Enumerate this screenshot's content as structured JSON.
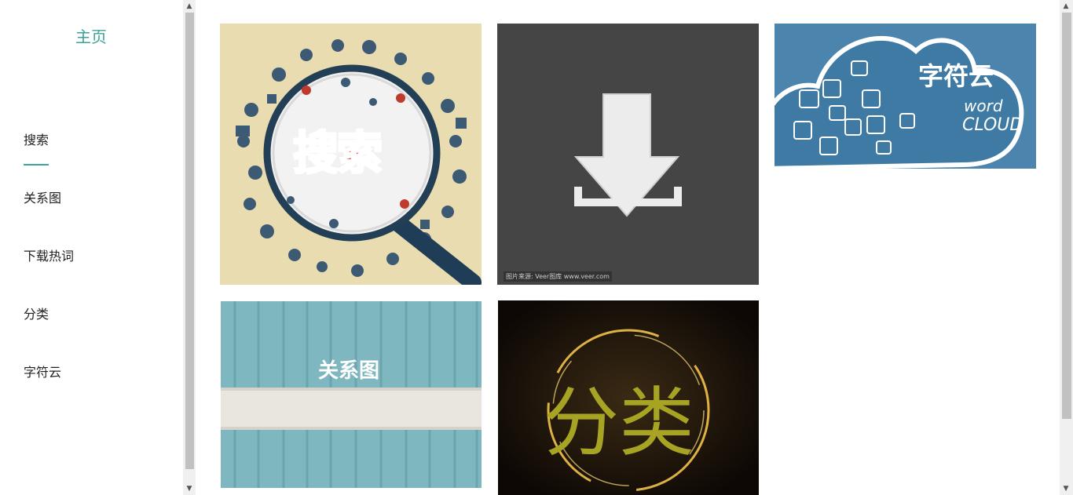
{
  "sidebar": {
    "home_label": "主页",
    "items": [
      {
        "label": "搜索"
      },
      {
        "label": "关系图"
      },
      {
        "label": "下载热词"
      },
      {
        "label": "分类"
      },
      {
        "label": "字符云"
      }
    ],
    "accent_color": "#3aa39a"
  },
  "tiles": {
    "search": {
      "text": "搜索",
      "bg_color": "#eadcb1"
    },
    "download": {
      "caption": "图片来源: Veer图库 www.veer.com",
      "bg_color": "#454545"
    },
    "wordcloud": {
      "title": "字符云",
      "word": "word",
      "cloud": "CLOUD",
      "bg_color": "#4b84ad"
    },
    "relation": {
      "text": "关系图",
      "bg_color": "#7fb7c0"
    },
    "category": {
      "text": "分类",
      "bg_color": "#1b120b",
      "text_color": "#a7a423"
    }
  }
}
